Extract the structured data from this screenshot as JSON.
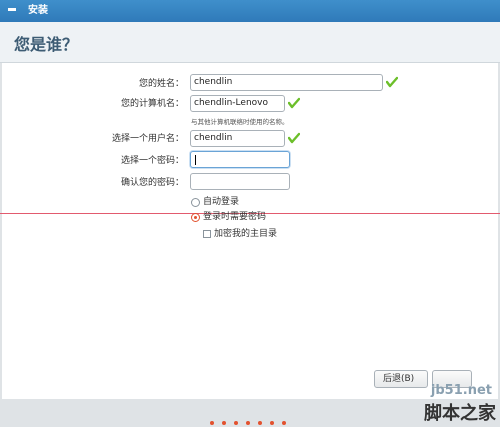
{
  "window": {
    "title": "安装",
    "close_icon": "minus-icon"
  },
  "page": {
    "heading": "您是谁？"
  },
  "form": {
    "name_label": "您的姓名：",
    "name_value": "chendlin",
    "computer_label": "您的计算机名：",
    "computer_value": "chendlin-Lenovo",
    "computer_hint": "与其他计算机联络时使用的名称。",
    "username_label": "选择一个用户名：",
    "username_value": "chendlin",
    "password_label": "选择一个密码：",
    "password_value": "",
    "confirm_label": "确认您的密码：",
    "confirm_value": ""
  },
  "login": {
    "auto_login_label": "自动登录",
    "require_password_label": "登录时需要密码",
    "encrypt_home_label": "加密我的主目录",
    "selected": "require_password",
    "encrypt_home_checked": false
  },
  "buttons": {
    "next_label": "后退(B)"
  },
  "progress": {
    "steps": 7
  },
  "watermark": {
    "site": "jb51.net",
    "brand": "脚本之家"
  },
  "colors": {
    "accent": "#2f7ab9",
    "check": "#6cbf2a",
    "selection": "#e2522f"
  }
}
